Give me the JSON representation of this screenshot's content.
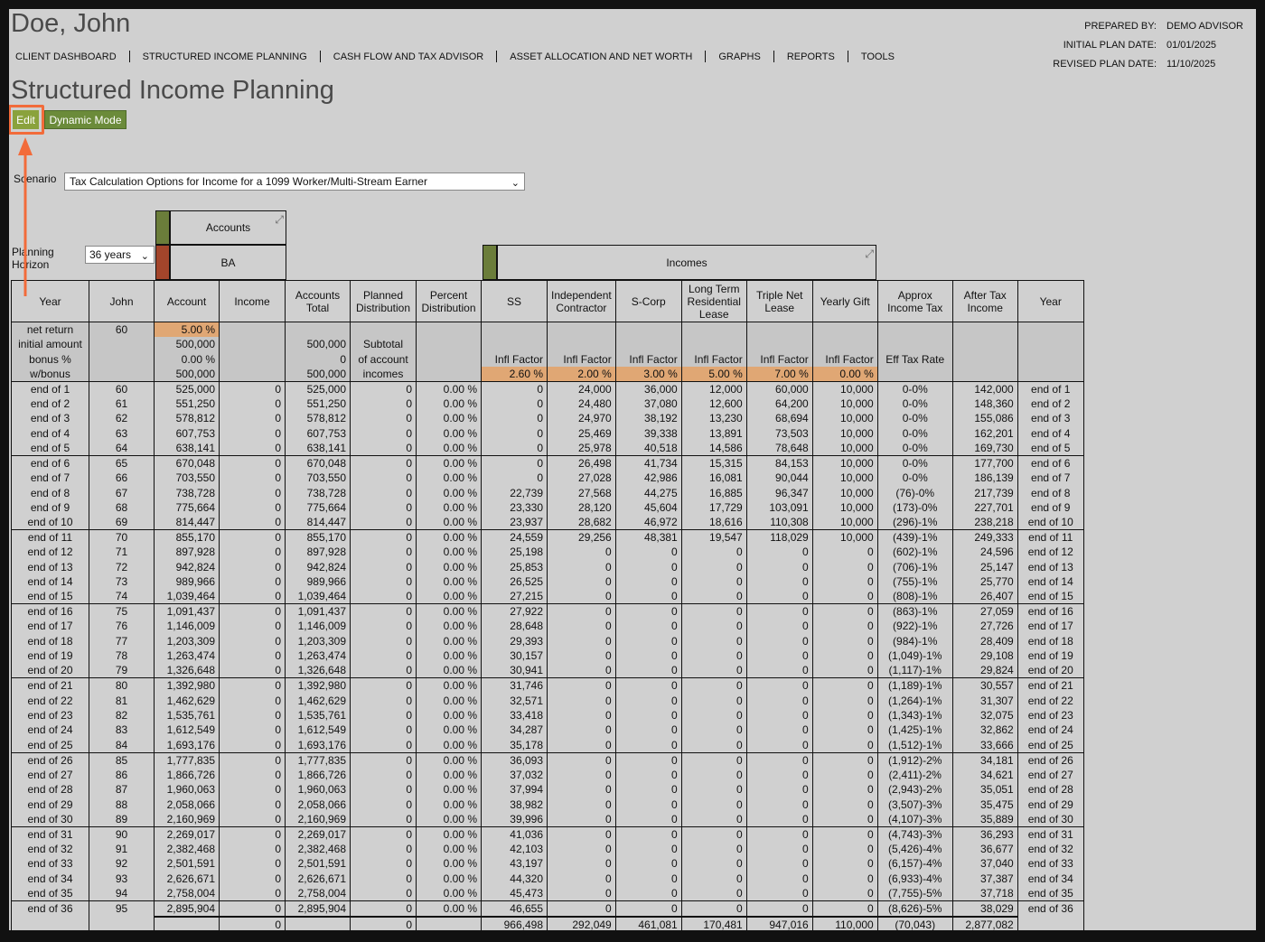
{
  "header": {
    "client_name": "Doe, John",
    "page_title": "Structured Income Planning",
    "nav": [
      "CLIENT DASHBOARD",
      "STRUCTURED INCOME PLANNING",
      "CASH FLOW AND TAX ADVISOR",
      "ASSET ALLOCATION AND NET WORTH",
      "GRAPHS",
      "REPORTS",
      "TOOLS"
    ],
    "prepared_by_label": "PREPARED BY:",
    "prepared_by": "DEMO ADVISOR",
    "initial_label": "INITIAL PLAN DATE:",
    "initial_date": "01/01/2025",
    "revised_label": "REVISED PLAN DATE:",
    "revised_date": "11/10/2025"
  },
  "buttons": {
    "edit": "Edit",
    "dynamic": "Dynamic Mode"
  },
  "scenario": {
    "label": "Scenario",
    "value": "Tax Calculation Options for Income for a 1099 Worker/Multi-Stream Earner"
  },
  "planning": {
    "label": "Planning Horizon",
    "value": "36 years"
  },
  "groups": {
    "accounts": "Accounts",
    "ba": "BA",
    "incomes": "Incomes"
  },
  "colors": {
    "green": "#6b7d3a",
    "red": "#a3452b",
    "highlight": "#f26b3a",
    "orange": "#e0a774"
  },
  "columns": [
    "Year",
    "John",
    "Account",
    "Income",
    "Accounts Total",
    "Planned Distribution",
    "Percent Distribution",
    "SS",
    "Independent Contractor",
    "S-Corp",
    "Long Term Residential Lease",
    "Triple Net Lease",
    "Yearly Gift",
    "Approx Income Tax",
    "After Tax Income",
    "Year"
  ],
  "pre": {
    "labels": [
      "net return",
      "initial amount",
      "bonus %",
      "w/bonus"
    ],
    "john": "60",
    "account": [
      "5.00 %",
      "500,000",
      "0.00 %",
      "500,000"
    ],
    "total": [
      "",
      "500,000",
      "0",
      "500,000"
    ],
    "planned": [
      "",
      "Subtotal",
      "of account",
      "incomes"
    ],
    "infl_label": "Infl Factor",
    "eff_label": "Eff Tax Rate",
    "infl": [
      "2.60 %",
      "2.00 %",
      "3.00 %",
      "5.00 %",
      "7.00 %",
      "0.00 %"
    ]
  },
  "rows": [
    [
      "end of 1",
      "60",
      "525,000",
      "0",
      "525,000",
      "0",
      "0.00 %",
      "0",
      "24,000",
      "36,000",
      "12,000",
      "60,000",
      "10,000",
      "0-0%",
      "142,000",
      "end of 1"
    ],
    [
      "end of 2",
      "61",
      "551,250",
      "0",
      "551,250",
      "0",
      "0.00 %",
      "0",
      "24,480",
      "37,080",
      "12,600",
      "64,200",
      "10,000",
      "0-0%",
      "148,360",
      "end of 2"
    ],
    [
      "end of 3",
      "62",
      "578,812",
      "0",
      "578,812",
      "0",
      "0.00 %",
      "0",
      "24,970",
      "38,192",
      "13,230",
      "68,694",
      "10,000",
      "0-0%",
      "155,086",
      "end of 3"
    ],
    [
      "end of 4",
      "63",
      "607,753",
      "0",
      "607,753",
      "0",
      "0.00 %",
      "0",
      "25,469",
      "39,338",
      "13,891",
      "73,503",
      "10,000",
      "0-0%",
      "162,201",
      "end of 4"
    ],
    [
      "end of 5",
      "64",
      "638,141",
      "0",
      "638,141",
      "0",
      "0.00 %",
      "0",
      "25,978",
      "40,518",
      "14,586",
      "78,648",
      "10,000",
      "0-0%",
      "169,730",
      "end of 5"
    ],
    [
      "end of 6",
      "65",
      "670,048",
      "0",
      "670,048",
      "0",
      "0.00 %",
      "0",
      "26,498",
      "41,734",
      "15,315",
      "84,153",
      "10,000",
      "0-0%",
      "177,700",
      "end of 6"
    ],
    [
      "end of 7",
      "66",
      "703,550",
      "0",
      "703,550",
      "0",
      "0.00 %",
      "0",
      "27,028",
      "42,986",
      "16,081",
      "90,044",
      "10,000",
      "0-0%",
      "186,139",
      "end of 7"
    ],
    [
      "end of 8",
      "67",
      "738,728",
      "0",
      "738,728",
      "0",
      "0.00 %",
      "22,739",
      "27,568",
      "44,275",
      "16,885",
      "96,347",
      "10,000",
      "(76)-0%",
      "217,739",
      "end of 8"
    ],
    [
      "end of 9",
      "68",
      "775,664",
      "0",
      "775,664",
      "0",
      "0.00 %",
      "23,330",
      "28,120",
      "45,604",
      "17,729",
      "103,091",
      "10,000",
      "(173)-0%",
      "227,701",
      "end of 9"
    ],
    [
      "end of 10",
      "69",
      "814,447",
      "0",
      "814,447",
      "0",
      "0.00 %",
      "23,937",
      "28,682",
      "46,972",
      "18,616",
      "110,308",
      "10,000",
      "(296)-1%",
      "238,218",
      "end of 10"
    ],
    [
      "end of 11",
      "70",
      "855,170",
      "0",
      "855,170",
      "0",
      "0.00 %",
      "24,559",
      "29,256",
      "48,381",
      "19,547",
      "118,029",
      "10,000",
      "(439)-1%",
      "249,333",
      "end of 11"
    ],
    [
      "end of 12",
      "71",
      "897,928",
      "0",
      "897,928",
      "0",
      "0.00 %",
      "25,198",
      "0",
      "0",
      "0",
      "0",
      "0",
      "(602)-1%",
      "24,596",
      "end of 12"
    ],
    [
      "end of 13",
      "72",
      "942,824",
      "0",
      "942,824",
      "0",
      "0.00 %",
      "25,853",
      "0",
      "0",
      "0",
      "0",
      "0",
      "(706)-1%",
      "25,147",
      "end of 13"
    ],
    [
      "end of 14",
      "73",
      "989,966",
      "0",
      "989,966",
      "0",
      "0.00 %",
      "26,525",
      "0",
      "0",
      "0",
      "0",
      "0",
      "(755)-1%",
      "25,770",
      "end of 14"
    ],
    [
      "end of 15",
      "74",
      "1,039,464",
      "0",
      "1,039,464",
      "0",
      "0.00 %",
      "27,215",
      "0",
      "0",
      "0",
      "0",
      "0",
      "(808)-1%",
      "26,407",
      "end of 15"
    ],
    [
      "end of 16",
      "75",
      "1,091,437",
      "0",
      "1,091,437",
      "0",
      "0.00 %",
      "27,922",
      "0",
      "0",
      "0",
      "0",
      "0",
      "(863)-1%",
      "27,059",
      "end of 16"
    ],
    [
      "end of 17",
      "76",
      "1,146,009",
      "0",
      "1,146,009",
      "0",
      "0.00 %",
      "28,648",
      "0",
      "0",
      "0",
      "0",
      "0",
      "(922)-1%",
      "27,726",
      "end of 17"
    ],
    [
      "end of 18",
      "77",
      "1,203,309",
      "0",
      "1,203,309",
      "0",
      "0.00 %",
      "29,393",
      "0",
      "0",
      "0",
      "0",
      "0",
      "(984)-1%",
      "28,409",
      "end of 18"
    ],
    [
      "end of 19",
      "78",
      "1,263,474",
      "0",
      "1,263,474",
      "0",
      "0.00 %",
      "30,157",
      "0",
      "0",
      "0",
      "0",
      "0",
      "(1,049)-1%",
      "29,108",
      "end of 19"
    ],
    [
      "end of 20",
      "79",
      "1,326,648",
      "0",
      "1,326,648",
      "0",
      "0.00 %",
      "30,941",
      "0",
      "0",
      "0",
      "0",
      "0",
      "(1,117)-1%",
      "29,824",
      "end of 20"
    ],
    [
      "end of 21",
      "80",
      "1,392,980",
      "0",
      "1,392,980",
      "0",
      "0.00 %",
      "31,746",
      "0",
      "0",
      "0",
      "0",
      "0",
      "(1,189)-1%",
      "30,557",
      "end of 21"
    ],
    [
      "end of 22",
      "81",
      "1,462,629",
      "0",
      "1,462,629",
      "0",
      "0.00 %",
      "32,571",
      "0",
      "0",
      "0",
      "0",
      "0",
      "(1,264)-1%",
      "31,307",
      "end of 22"
    ],
    [
      "end of 23",
      "82",
      "1,535,761",
      "0",
      "1,535,761",
      "0",
      "0.00 %",
      "33,418",
      "0",
      "0",
      "0",
      "0",
      "0",
      "(1,343)-1%",
      "32,075",
      "end of 23"
    ],
    [
      "end of 24",
      "83",
      "1,612,549",
      "0",
      "1,612,549",
      "0",
      "0.00 %",
      "34,287",
      "0",
      "0",
      "0",
      "0",
      "0",
      "(1,425)-1%",
      "32,862",
      "end of 24"
    ],
    [
      "end of 25",
      "84",
      "1,693,176",
      "0",
      "1,693,176",
      "0",
      "0.00 %",
      "35,178",
      "0",
      "0",
      "0",
      "0",
      "0",
      "(1,512)-1%",
      "33,666",
      "end of 25"
    ],
    [
      "end of 26",
      "85",
      "1,777,835",
      "0",
      "1,777,835",
      "0",
      "0.00 %",
      "36,093",
      "0",
      "0",
      "0",
      "0",
      "0",
      "(1,912)-2%",
      "34,181",
      "end of 26"
    ],
    [
      "end of 27",
      "86",
      "1,866,726",
      "0",
      "1,866,726",
      "0",
      "0.00 %",
      "37,032",
      "0",
      "0",
      "0",
      "0",
      "0",
      "(2,411)-2%",
      "34,621",
      "end of 27"
    ],
    [
      "end of 28",
      "87",
      "1,960,063",
      "0",
      "1,960,063",
      "0",
      "0.00 %",
      "37,994",
      "0",
      "0",
      "0",
      "0",
      "0",
      "(2,943)-2%",
      "35,051",
      "end of 28"
    ],
    [
      "end of 29",
      "88",
      "2,058,066",
      "0",
      "2,058,066",
      "0",
      "0.00 %",
      "38,982",
      "0",
      "0",
      "0",
      "0",
      "0",
      "(3,507)-3%",
      "35,475",
      "end of 29"
    ],
    [
      "end of 30",
      "89",
      "2,160,969",
      "0",
      "2,160,969",
      "0",
      "0.00 %",
      "39,996",
      "0",
      "0",
      "0",
      "0",
      "0",
      "(4,107)-3%",
      "35,889",
      "end of 30"
    ],
    [
      "end of 31",
      "90",
      "2,269,017",
      "0",
      "2,269,017",
      "0",
      "0.00 %",
      "41,036",
      "0",
      "0",
      "0",
      "0",
      "0",
      "(4,743)-3%",
      "36,293",
      "end of 31"
    ],
    [
      "end of 32",
      "91",
      "2,382,468",
      "0",
      "2,382,468",
      "0",
      "0.00 %",
      "42,103",
      "0",
      "0",
      "0",
      "0",
      "0",
      "(5,426)-4%",
      "36,677",
      "end of 32"
    ],
    [
      "end of 33",
      "92",
      "2,501,591",
      "0",
      "2,501,591",
      "0",
      "0.00 %",
      "43,197",
      "0",
      "0",
      "0",
      "0",
      "0",
      "(6,157)-4%",
      "37,040",
      "end of 33"
    ],
    [
      "end of 34",
      "93",
      "2,626,671",
      "0",
      "2,626,671",
      "0",
      "0.00 %",
      "44,320",
      "0",
      "0",
      "0",
      "0",
      "0",
      "(6,933)-4%",
      "37,387",
      "end of 34"
    ],
    [
      "end of 35",
      "94",
      "2,758,004",
      "0",
      "2,758,004",
      "0",
      "0.00 %",
      "45,473",
      "0",
      "0",
      "0",
      "0",
      "0",
      "(7,755)-5%",
      "37,718",
      "end of 35"
    ],
    [
      "end of 36",
      "95",
      "2,895,904",
      "0",
      "2,895,904",
      "0",
      "0.00 %",
      "46,655",
      "0",
      "0",
      "0",
      "0",
      "0",
      "(8,626)-5%",
      "38,029",
      "end of 36"
    ]
  ],
  "totals": [
    "",
    "",
    "",
    "0",
    "",
    "0",
    "",
    "966,498",
    "292,049",
    "461,081",
    "170,481",
    "947,016",
    "110,000",
    "(70,043)",
    "2,877,082",
    ""
  ]
}
